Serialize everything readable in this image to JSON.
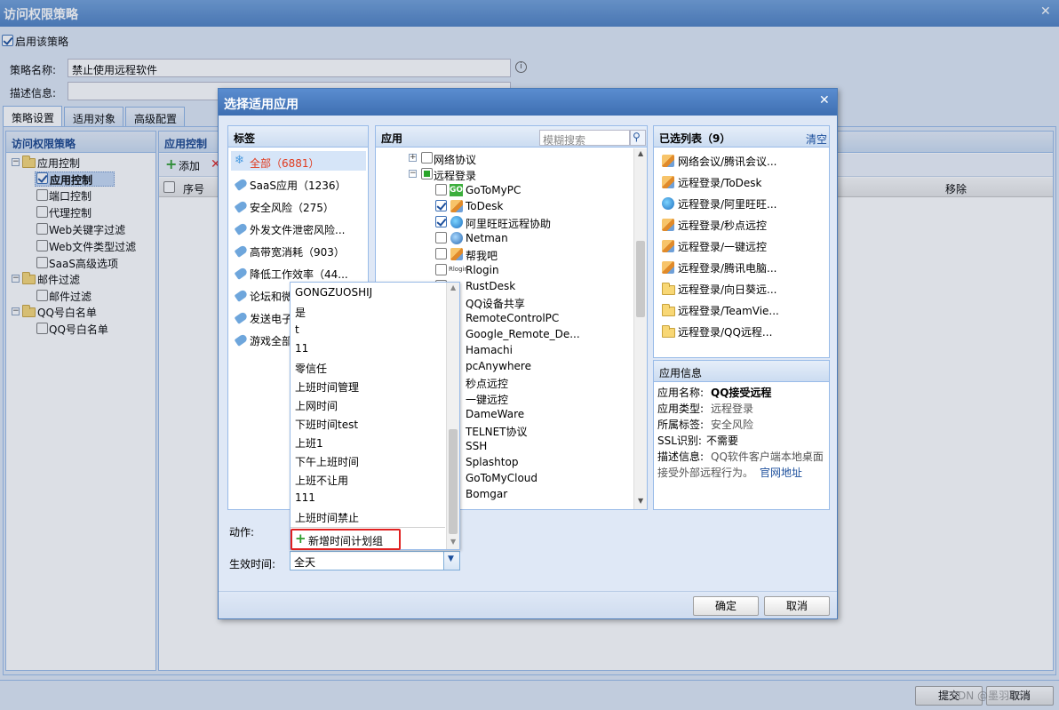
{
  "window": {
    "title": "访问权限策略",
    "close": "✕"
  },
  "enable": {
    "label": "启用该策略"
  },
  "form": {
    "name_label": "策略名称:",
    "name_value": "禁止使用远程软件",
    "desc_label": "描述信息:"
  },
  "tabs": [
    "策略设置",
    "适用对象",
    "高级配置"
  ],
  "left_tree": {
    "title": "访问权限策略",
    "items": [
      {
        "label": "应用控制"
      },
      {
        "label": "应用控制"
      },
      {
        "label": "端口控制"
      },
      {
        "label": "代理控制"
      },
      {
        "label": "Web关键字过滤"
      },
      {
        "label": "Web文件类型过滤"
      },
      {
        "label": "SaaS高级选项"
      },
      {
        "label": "邮件过滤"
      },
      {
        "label": "邮件过滤"
      },
      {
        "label": "QQ号白名单"
      },
      {
        "label": "QQ号白名单"
      }
    ]
  },
  "center": {
    "title": "应用控制",
    "add": "添加",
    "col_seq": "序号",
    "col_remove": "移除"
  },
  "footer": {
    "submit": "提交",
    "cancel": "取消",
    "watermark": "CSDN @墨羽866"
  },
  "dialog": {
    "title": "选择适用应用",
    "close": "✕",
    "tags_title": "标签",
    "tags": [
      {
        "label": "全部（6881）"
      },
      {
        "label": "SaaS应用（1236）"
      },
      {
        "label": "安全风险（275）"
      },
      {
        "label": "外发文件泄密风险..."
      },
      {
        "label": "高带宽消耗（903）"
      },
      {
        "label": "降低工作效率（44..."
      },
      {
        "label": "论坛和微"
      },
      {
        "label": "发送电子"
      },
      {
        "label": "游戏全部"
      }
    ],
    "apps_title": "应用",
    "search_placeholder": "模糊搜索",
    "apps_tree": [
      {
        "label": "网络协议"
      },
      {
        "label": "远程登录"
      },
      {
        "label": "GoToMyPC"
      },
      {
        "label": "ToDesk"
      },
      {
        "label": "阿里旺旺远程协助"
      },
      {
        "label": "Netman"
      },
      {
        "label": "帮我吧"
      },
      {
        "label": "Rlogin"
      },
      {
        "label": "RustDesk"
      },
      {
        "label": "QQ设备共享"
      },
      {
        "label": "RemoteControlPC"
      },
      {
        "label": "Google_Remote_De..."
      },
      {
        "label": "Hamachi"
      },
      {
        "label": "pcAnywhere"
      },
      {
        "label": "秒点远控"
      },
      {
        "label": "一键远控"
      },
      {
        "label": "DameWare"
      },
      {
        "label": "TELNET协议"
      },
      {
        "label": "SSH"
      },
      {
        "label": "Splashtop"
      },
      {
        "label": "GoToMyCloud"
      },
      {
        "label": "Bomgar"
      }
    ],
    "selected_title": "已选列表（9）",
    "clear": "清空",
    "selected": [
      {
        "label": "网络会议/腾讯会议..."
      },
      {
        "label": "远程登录/ToDesk"
      },
      {
        "label": "远程登录/阿里旺旺..."
      },
      {
        "label": "远程登录/秒点远控"
      },
      {
        "label": "远程登录/一键远控"
      },
      {
        "label": "远程登录/腾讯电脑..."
      },
      {
        "label": "远程登录/向日葵远..."
      },
      {
        "label": "远程登录/TeamVie..."
      },
      {
        "label": "远程登录/QQ远程..."
      }
    ],
    "info": {
      "title": "应用信息",
      "name_label": "应用名称:",
      "name_value": "QQ接受远程",
      "type_label": "应用类型:",
      "type_value": "远程登录",
      "tag_label": "所属标签:",
      "tag_value": "安全风险",
      "ssl_label": "SSL识别:",
      "ssl_value": "不需要",
      "desc_label": "描述信息:",
      "desc_value": "QQ软件客户端本地桌面",
      "desc_value2": "接受外部远程行为。",
      "link": "官网地址"
    },
    "action_label": "动作:",
    "time_label": "生效时间:",
    "time_value": "全天",
    "dropdown": [
      {
        "label": "GONGZUOSHIJ"
      },
      {
        "label": "是"
      },
      {
        "label": "t"
      },
      {
        "label": "11"
      },
      {
        "label": "零信任"
      },
      {
        "label": "上班时间管理"
      },
      {
        "label": "上网时间"
      },
      {
        "label": "下班时间test"
      },
      {
        "label": "上班1"
      },
      {
        "label": "下午上班时间"
      },
      {
        "label": "上班不让用"
      },
      {
        "label": "111"
      },
      {
        "label": "上班时间禁止"
      }
    ],
    "add_group": "新增时间计划组",
    "ok": "确定",
    "cancel": "取消"
  }
}
